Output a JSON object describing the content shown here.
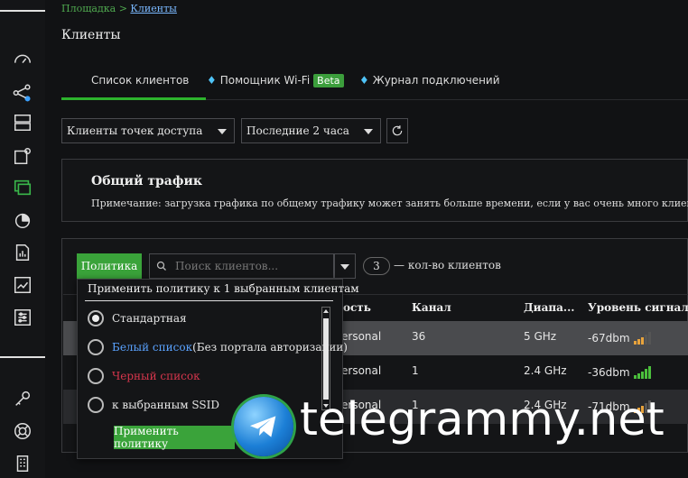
{
  "breadcrumb": {
    "root": "Площадка >",
    "current": "Клиенты"
  },
  "page_title": "Клиенты",
  "tabs": [
    {
      "label": "Список клиентов"
    },
    {
      "label": "Помощник Wi-Fi",
      "badge": "Beta"
    },
    {
      "label": "Журнал подключений"
    }
  ],
  "filters": {
    "client_type": "Клиенты точек доступа",
    "period": "Последние 2 часа"
  },
  "traffic": {
    "heading": "Общий трафик",
    "note": "Примечание: загрузка графика по общему трафику может занять больше времени, если у вас очень много клиентов."
  },
  "toolbar": {
    "policy_label": "Политика",
    "search_placeholder": "Поиск клиентов...",
    "count": "3",
    "count_label": "— кол-во клиентов"
  },
  "table": {
    "headers": [
      "ость",
      "Канал",
      "Диапа...",
      "Уровень сигнала"
    ],
    "rows": [
      {
        "security": "ersonal",
        "channel": "36",
        "band": "5 GHz",
        "signal": "-67dbm",
        "signal_level": 3,
        "signal_color": "#e8a33c"
      },
      {
        "security": "ersonal",
        "channel": "1",
        "band": "2.4 GHz",
        "signal": "-36dbm",
        "signal_level": 5,
        "signal_color": "#4bbf3c"
      },
      {
        "security": "ersonal",
        "channel": "1",
        "band": "2.4 GHz",
        "signal": "-71dbm",
        "signal_level": 3,
        "signal_color": "#e8a33c"
      }
    ]
  },
  "popup": {
    "title": "Применить политику к 1 выбранным клиентам",
    "options": [
      {
        "label": "Стандартная",
        "selected": true,
        "color": "#e6e6e6"
      },
      {
        "label": "Белый список",
        "suffix": " (Без портала авторизации)",
        "selected": false,
        "color": "#5aa2ff"
      },
      {
        "label": "Черный список",
        "selected": false,
        "color": "#d8364d"
      },
      {
        "label": "к выбранным SSID",
        "selected": false,
        "color": "#e6e6e6"
      }
    ],
    "apply_label": "Применить политику"
  },
  "watermark": {
    "text": "telegrammy.net"
  },
  "colors": {
    "accent": "#3aa33a",
    "background": "#111214",
    "panel": "#141517"
  }
}
